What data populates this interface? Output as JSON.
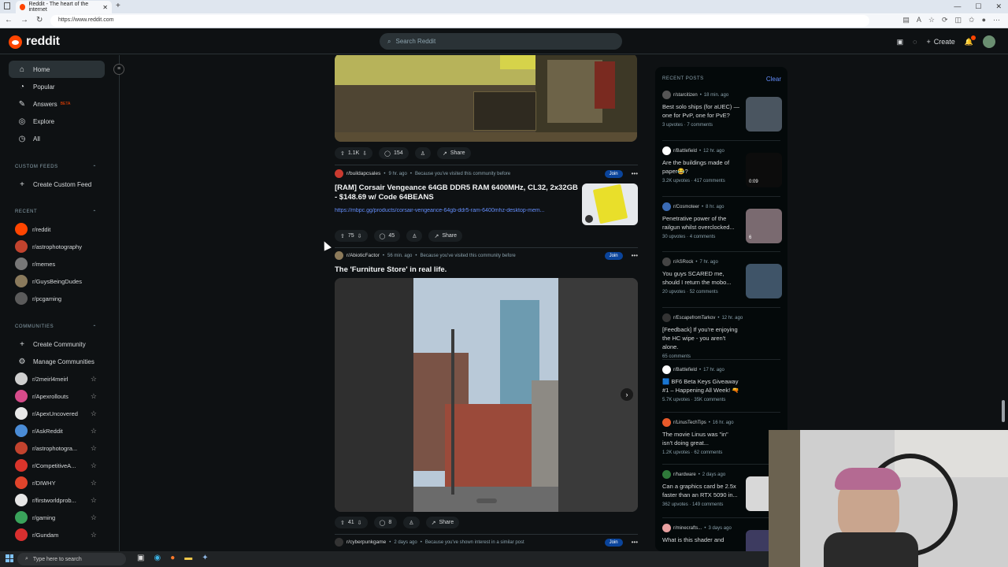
{
  "browser": {
    "tab_title": "Reddit - The heart of the internet",
    "url": "https://www.reddit.com"
  },
  "header": {
    "logo_text": "reddit",
    "search_placeholder": "Search Reddit",
    "create_label": "Create"
  },
  "sidebar": {
    "nav": [
      {
        "label": "Home",
        "icon": "home-icon"
      },
      {
        "label": "Popular",
        "icon": "popular-icon"
      },
      {
        "label": "Answers",
        "icon": "answers-icon",
        "badge": "BETA"
      },
      {
        "label": "Explore",
        "icon": "explore-icon"
      },
      {
        "label": "All",
        "icon": "all-icon"
      }
    ],
    "custom_feeds_header": "CUSTOM FEEDS",
    "create_custom_feed": "Create Custom Feed",
    "recent_header": "RECENT",
    "recent": [
      {
        "label": "r/reddit",
        "color": "#ff4500"
      },
      {
        "label": "r/astrophotography",
        "color": "#c2432e"
      },
      {
        "label": "r/memes",
        "color": "#777777"
      },
      {
        "label": "r/GuysBeingDudes",
        "color": "#8a7a5c"
      },
      {
        "label": "r/pcgaming",
        "color": "#5b5b5b"
      }
    ],
    "communities_header": "COMMUNITIES",
    "create_community": "Create Community",
    "manage_communities": "Manage Communities",
    "communities": [
      {
        "label": "r/2meirl4meirl",
        "color": "#cfcfcf"
      },
      {
        "label": "r/Apexrollouts",
        "color": "#d64b8a"
      },
      {
        "label": "r/ApexUncovered",
        "color": "#e8e8e8"
      },
      {
        "label": "r/AskReddit",
        "color": "#4a8cd6"
      },
      {
        "label": "r/astrophotogra...",
        "color": "#c2432e"
      },
      {
        "label": "r/CompetitiveA...",
        "color": "#d9342b"
      },
      {
        "label": "r/DIWHY",
        "color": "#e0442b"
      },
      {
        "label": "r/firstworldprob...",
        "color": "#e6e6e6"
      },
      {
        "label": "r/gaming",
        "color": "#3aa35b"
      },
      {
        "label": "r/Gundam",
        "color": "#d92f2f"
      }
    ]
  },
  "feed": {
    "post1_actions": {
      "votes": "1.1K",
      "comments": "154",
      "share": "Share"
    },
    "post2": {
      "subreddit": "r/buildapcsales",
      "time": "9 hr. ago",
      "reason": "Because you've visited this community before",
      "join": "Join",
      "title_line1": "[RAM] Corsair Vengeance 64GB DDR5 RAM 6400MHz, CL32, 2x32GB",
      "title_line2": "- $148.69 w/ Code 64BEANS",
      "link": "https://mbpc.gg/products/corsair-vengeance-64gb-ddr5-ram-6400mhz-desktop-mem...",
      "votes": "75",
      "comments": "45",
      "share": "Share"
    },
    "post3": {
      "subreddit": "r/AbioticFactor",
      "time": "56 min. ago",
      "reason": "Because you've visited this community before",
      "join": "Join",
      "title": "The 'Furniture Store' in real life.",
      "votes": "41",
      "comments": "8",
      "share": "Share"
    },
    "post4": {
      "subreddit": "r/cyberpunkgame",
      "time": "2 days ago",
      "reason": "Because you've shown interest in a similar post",
      "join": "Join"
    }
  },
  "recent_posts": {
    "header": "RECENT POSTS",
    "clear": "Clear",
    "items": [
      {
        "sub": "r/starcitizen",
        "time": "18 min. ago",
        "title": "Best solo ships (for aUEC) — one for PvP, one for PvE?",
        "stats": "3 upvotes · 7 comments",
        "thumb_color": "#4a5560"
      },
      {
        "sub": "r/Battlefield",
        "time": "12 hr. ago",
        "title": "Are the buildings made of paper😂?",
        "stats": "3.2K upvotes · 417 comments",
        "thumb_color": "#0c0c0c",
        "thumb_text": "0:09"
      },
      {
        "sub": "r/Cosmoteer",
        "time": "8 hr. ago",
        "title": "Penetrative power of the railgun whilst overclocked...",
        "stats": "30 upvotes · 4 comments",
        "thumb_color": "#7a6a70",
        "thumb_text": "6"
      },
      {
        "sub": "r/ASRock",
        "time": "7 hr. ago",
        "title": "You guys SCARED me, should I return the mobo...",
        "stats": "20 upvotes · 52 comments",
        "thumb_color": "#3f5468"
      },
      {
        "sub": "r/EscapefromTarkov",
        "time": "12 hr. ago",
        "title": "[Feedback] If you're enjoying the HC wipe - you aren't alone.",
        "stats": "65 comments"
      },
      {
        "sub": "r/Battlefield",
        "time": "17 hr. ago",
        "title": "🟦 BF6 Beta Keys Giveaway #1 – Happening All Week! 🔫",
        "stats": "5.7K upvotes · 35K comments"
      },
      {
        "sub": "r/LinusTechTips",
        "time": "16 hr. ago",
        "title": "The movie Linus was \"in\" isn't doing great...",
        "stats": "1.2K upvotes · 62 comments"
      },
      {
        "sub": "r/hardware",
        "time": "2 days ago",
        "title": "Can a graphics card be 2.5x faster than an RTX 5090 in...",
        "stats": "362 upvotes · 149 comments",
        "thumb_color": "#d8d8d8"
      },
      {
        "sub": "r/minecrafts...",
        "time": "3 days ago",
        "title": "What is this shader and",
        "stats": "",
        "thumb_color": "#3d3b60"
      }
    ]
  },
  "taskbar": {
    "search_placeholder": "Type here to search"
  }
}
